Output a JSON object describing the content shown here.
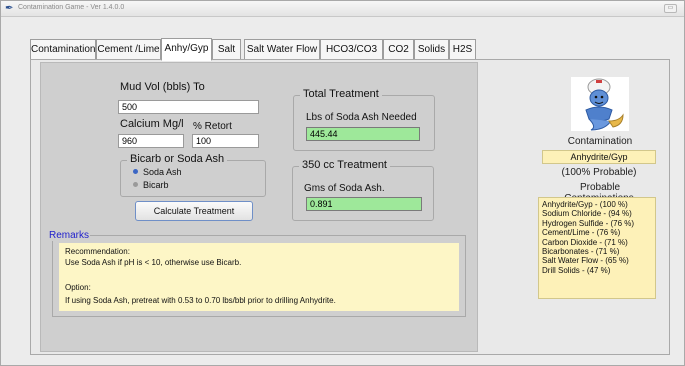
{
  "window": {
    "title": "Contamination Game - Ver 1.4.0.0"
  },
  "tabs": [
    {
      "label": "Contamination",
      "active": false
    },
    {
      "label": "Cement /Lime",
      "active": false
    },
    {
      "label": "Anhy/Gyp",
      "active": true
    },
    {
      "label": "Salt",
      "active": false
    },
    {
      "label": "Salt Water Flow",
      "active": false
    },
    {
      "label": "HCO3/CO3",
      "active": false
    },
    {
      "label": "CO2",
      "active": false
    },
    {
      "label": "Solids",
      "active": false
    },
    {
      "label": "H2S",
      "active": false
    }
  ],
  "inputs": {
    "mud_vol_label": "Mud Vol (bbls) To",
    "mud_vol_value": "500",
    "calcium_label": "Calcium Mg/l",
    "calcium_value": "960",
    "retort_label": "% Retort",
    "retort_value": "100"
  },
  "treatment_choice": {
    "title": "Bicarb or Soda Ash",
    "options": [
      {
        "label": "Soda Ash",
        "selected": true
      },
      {
        "label": "Bicarb",
        "selected": false
      }
    ]
  },
  "calculate_button": "Calculate Treatment",
  "total_treatment": {
    "title": "Total Treatment",
    "label": "Lbs of Soda Ash Needed",
    "value": "445.44"
  },
  "cc_treatment": {
    "title": "350 cc Treatment",
    "label": "Gms of Soda Ash.",
    "value": "0.891"
  },
  "remarks": {
    "title": "Remarks",
    "lines": [
      "Recommendation:",
      "Use Soda Ash if pH is < 10, otherwise use Bicarb.",
      "",
      "Option:",
      "If using Soda Ash, pretreat with 0.53 to 0.70 lbs/bbl prior to drilling Anhydrite."
    ]
  },
  "result": {
    "contamination_label": "Contamination",
    "contamination_value": "Anhydrite/Gyp",
    "probability_text": "(100% Probable)",
    "probable_title_line1": "Probable",
    "probable_title_line2": "Contaminations",
    "probable_list": [
      "Anhydrite/Gyp - (100 %)",
      "Sodium Chloride - (94 %)",
      "Hydrogen Sulfide - (76 %)",
      "Cement/Lime - (76 %)",
      "Carbon Dioxide - (71 %)",
      "Bicarbonates - (71 %)",
      "Salt Water Flow - (65 %)",
      "Drill Solids - (47 %)"
    ]
  },
  "icons": {
    "app": "app-icon",
    "genie": "genie-icon",
    "window_control": "restore-icon"
  },
  "colors": {
    "result_green": "#9ee89a",
    "remarks_yellow": "#fdf6c6",
    "badge_yellow": "#fdf1b8",
    "remarks_title_blue": "#2222cc",
    "radio_selected": "#3b66c4"
  }
}
